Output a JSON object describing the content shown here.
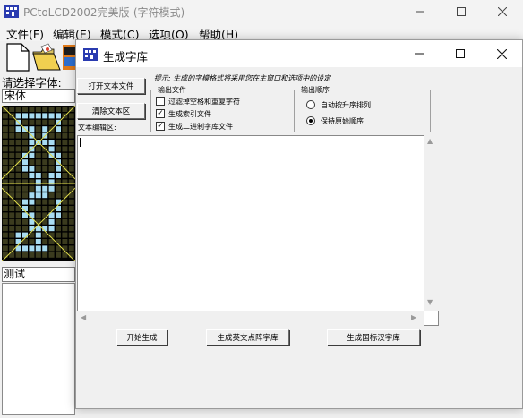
{
  "main_window": {
    "title": "PCtoLCD2002完美版-(字符模式)",
    "app_icon": "grid-icon"
  },
  "menu": [
    "文件(F)",
    "编辑(E)",
    "模式(C)",
    "选项(O)",
    "帮助(H)"
  ],
  "left_panel": {
    "font_label": "请选择字体:",
    "font_value": "宋体",
    "test_text": "测试"
  },
  "dialog": {
    "title": "生成字库",
    "hint": "提示: 生成的字模格式将采用您在主窗口和选项中的设定",
    "open_text_button": "打开文本文件",
    "clear_text_button": "清除文本区",
    "edit_area_label": "文本编辑区:",
    "output_files": {
      "legend": "输出文件",
      "items": [
        {
          "label": "过滤掉空格和重复字符",
          "checked": false
        },
        {
          "label": "生成索引文件",
          "checked": true
        },
        {
          "label": "生成二进制字库文件",
          "checked": true
        }
      ]
    },
    "output_order": {
      "legend": "输出顺序",
      "items": [
        {
          "label": "自动按升序排列",
          "selected": false
        },
        {
          "label": "保持原始顺序",
          "selected": true
        }
      ]
    },
    "editor_text": "",
    "buttons": {
      "start": "开始生成",
      "english": "生成英文点阵字库",
      "gb": "生成国标汉字库"
    }
  },
  "colors": {
    "preview_bg": "#000000",
    "pixel_off": "#3b3b1e",
    "pixel_on": "#a8dcf2",
    "guide_line": "#e0dc4a"
  }
}
